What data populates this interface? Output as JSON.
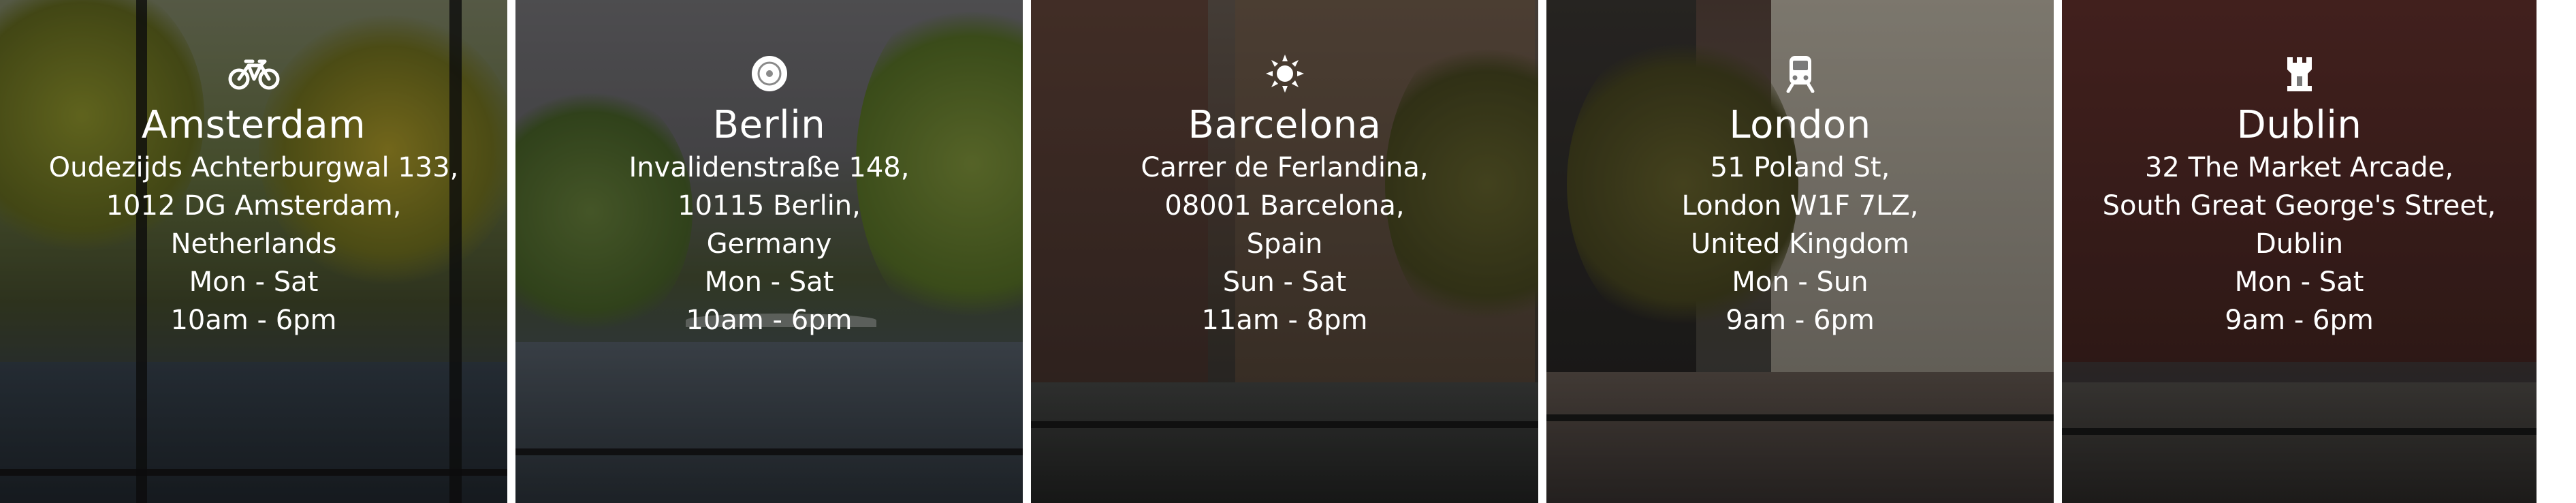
{
  "colors": {
    "text": "#ffffff",
    "divider": "#ffffff",
    "overlay": "rgba(0,0,0,0.38)"
  },
  "locations": [
    {
      "icon": "bicycle-icon",
      "city": "Amsterdam",
      "address": [
        "Oudezijds Achterburgwal 133,",
        "1012 DG Amsterdam,",
        "Netherlands"
      ],
      "days": "Mon - Sat",
      "hours": "10am - 6pm"
    },
    {
      "icon": "vinyl-record-icon",
      "city": "Berlin",
      "address": [
        "Invalidenstraße 148,",
        "10115 Berlin,",
        "Germany"
      ],
      "days": "Mon - Sat",
      "hours": "10am - 6pm"
    },
    {
      "icon": "sun-icon",
      "city": "Barcelona",
      "address": [
        "Carrer de Ferlandina,",
        "08001 Barcelona,",
        "Spain"
      ],
      "days": "Sun - Sat",
      "hours": "11am - 8pm"
    },
    {
      "icon": "train-icon",
      "city": "London",
      "address": [
        "51 Poland St,",
        "London W1F 7LZ,",
        "United Kingdom"
      ],
      "days": "Mon - Sun",
      "hours": "9am - 6pm"
    },
    {
      "icon": "castle-tower-icon",
      "city": "Dublin",
      "address": [
        "32 The Market Arcade,",
        "South Great George's Street,",
        "Dublin"
      ],
      "days": "Mon - Sat",
      "hours": "9am - 6pm"
    }
  ]
}
